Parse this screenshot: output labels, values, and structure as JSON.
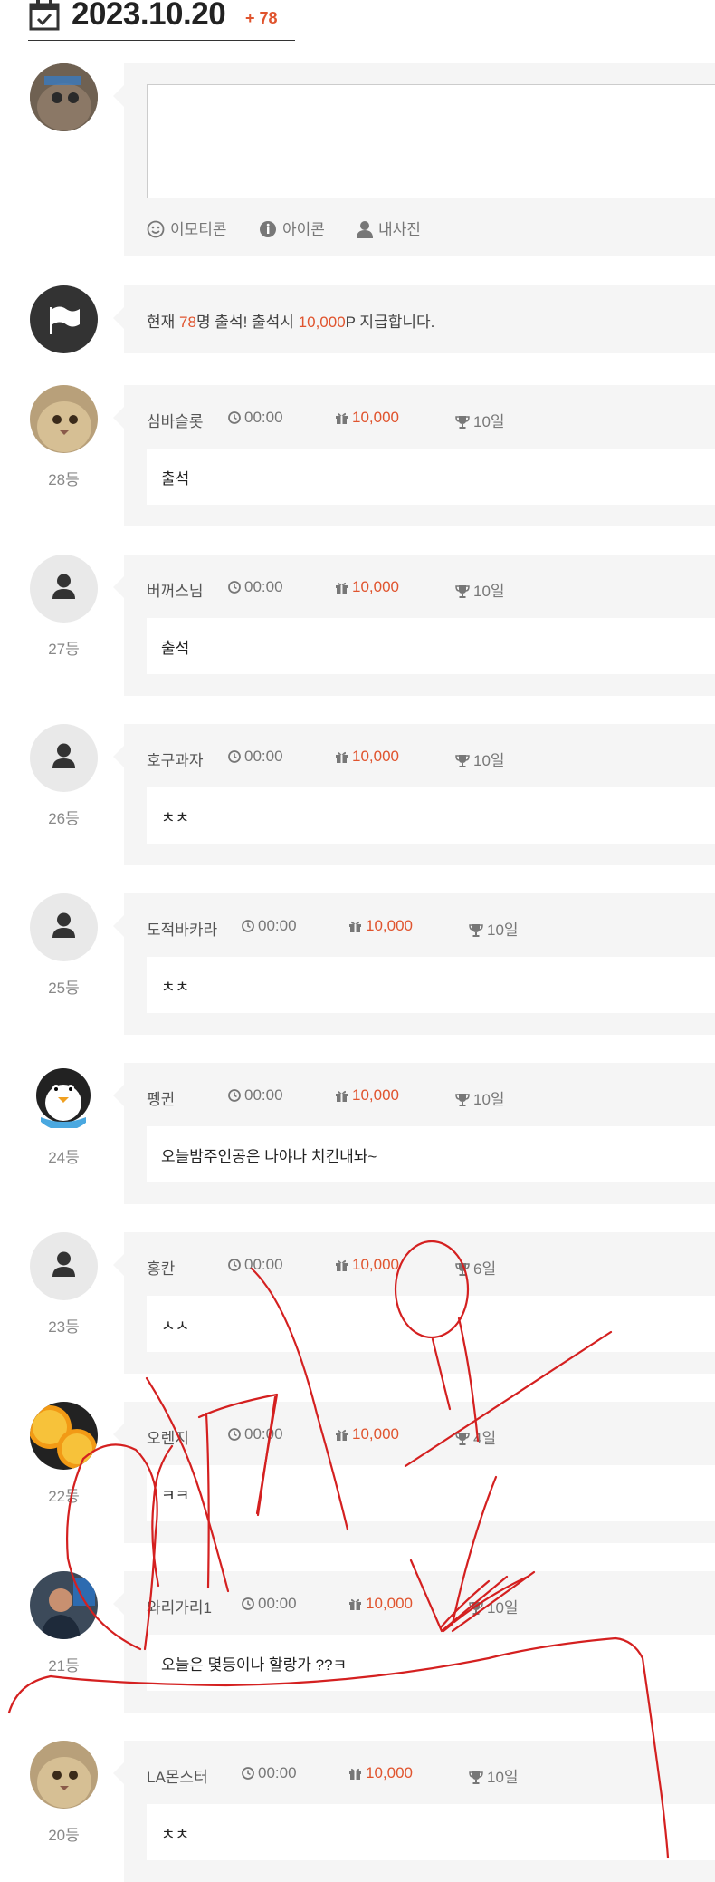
{
  "header": {
    "date": "2023.10.20",
    "count": "+ 78"
  },
  "editor": {
    "tools": [
      {
        "label": "이모티콘",
        "icon": "smile-icon"
      },
      {
        "label": "아이콘",
        "icon": "info-icon"
      },
      {
        "label": "내사진",
        "icon": "user-icon"
      }
    ]
  },
  "notice": {
    "prefix": "현재 ",
    "count": "78",
    "middle": "명 출석! 출석시 ",
    "points": "10,000",
    "suffix": "P 지급합니다."
  },
  "entries": [
    {
      "rank": "28등",
      "name": "심바슬롯",
      "time": "00:00",
      "points": "10,000",
      "days": "10일",
      "message": "출석",
      "avatar": "cat-photo"
    },
    {
      "rank": "27등",
      "name": "버꺼스님",
      "time": "00:00",
      "points": "10,000",
      "days": "10일",
      "message": "출석",
      "avatar": "default-user"
    },
    {
      "rank": "26등",
      "name": "호구과자",
      "time": "00:00",
      "points": "10,000",
      "days": "10일",
      "message": "ㅊㅊ",
      "avatar": "default-user"
    },
    {
      "rank": "25등",
      "name": "도적바카라",
      "time": "00:00",
      "points": "10,000",
      "days": "10일",
      "message": "ㅊㅊ",
      "avatar": "default-user"
    },
    {
      "rank": "24등",
      "name": "펭귄",
      "time": "00:00",
      "points": "10,000",
      "days": "10일",
      "message": "오늘밤주인공은 나야나 치킨내놔~",
      "avatar": "penguin"
    },
    {
      "rank": "23등",
      "name": "홍칸",
      "time": "00:00",
      "points": "10,000",
      "days": "6일",
      "message": "ㅅㅅ",
      "avatar": "default-user"
    },
    {
      "rank": "22등",
      "name": "오렌지",
      "time": "00:00",
      "points": "10,000",
      "days": "4일",
      "message": "ㅋㅋ",
      "avatar": "orange-photo"
    },
    {
      "rank": "21등",
      "name": "와리가리1",
      "time": "00:00",
      "points": "10,000",
      "days": "10일",
      "message": "오늘은 몇등이나 할랑가 ??ㅋ",
      "avatar": "man-photo"
    },
    {
      "rank": "20등",
      "name": "LA몬스터",
      "time": "00:00",
      "points": "10,000",
      "days": "10일",
      "message": "ㅊㅊ",
      "avatar": "cat-photo"
    }
  ],
  "colors": {
    "accent": "#e0542e",
    "card": "#f5f5f5",
    "scribble": "#d42020"
  }
}
